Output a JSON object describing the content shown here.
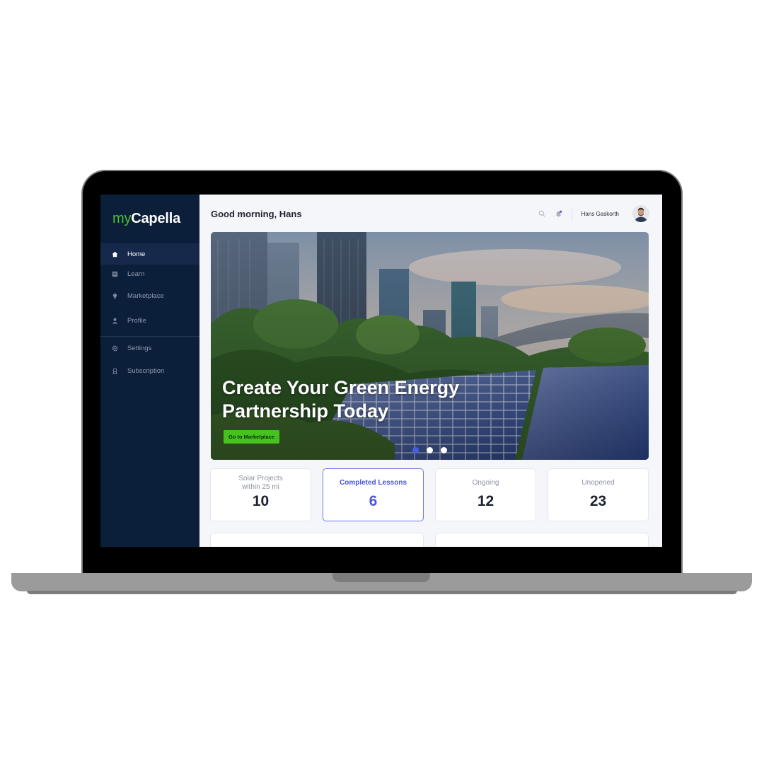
{
  "app": {
    "logo_prefix": "my",
    "logo_name": "Capella"
  },
  "sidebar": {
    "items": [
      {
        "label": "Home",
        "icon": "home-icon",
        "active": true
      },
      {
        "label": "Learn",
        "icon": "book-icon",
        "active": false
      },
      {
        "label": "Marketplace",
        "icon": "lightbulb-icon",
        "active": false
      },
      {
        "label": "Profile",
        "icon": "user-icon",
        "active": false
      }
    ],
    "secondary_items": [
      {
        "label": "Settings",
        "icon": "gear-icon"
      },
      {
        "label": "Subscription",
        "icon": "badge-icon"
      }
    ]
  },
  "header": {
    "greeting": "Good morning, Hans",
    "user_name": "Hans Gaskorth"
  },
  "hero": {
    "title": "Create Your Green Energy Partnership Today",
    "button_label": "Go to Marketplace",
    "slides_total": 3,
    "active_slide": 1
  },
  "stats": [
    {
      "label": "Solar Projects within 25 mi",
      "value": "10",
      "selected": false
    },
    {
      "label": "Completed Lessons",
      "value": "6",
      "selected": true
    },
    {
      "label": "Ongoing",
      "value": "12",
      "selected": false
    },
    {
      "label": "Unopened",
      "value": "23",
      "selected": false
    }
  ],
  "colors": {
    "sidebar_bg": "#0c1f3a",
    "brand_green": "#4fc12a",
    "accent_blue": "#4a57e8"
  }
}
